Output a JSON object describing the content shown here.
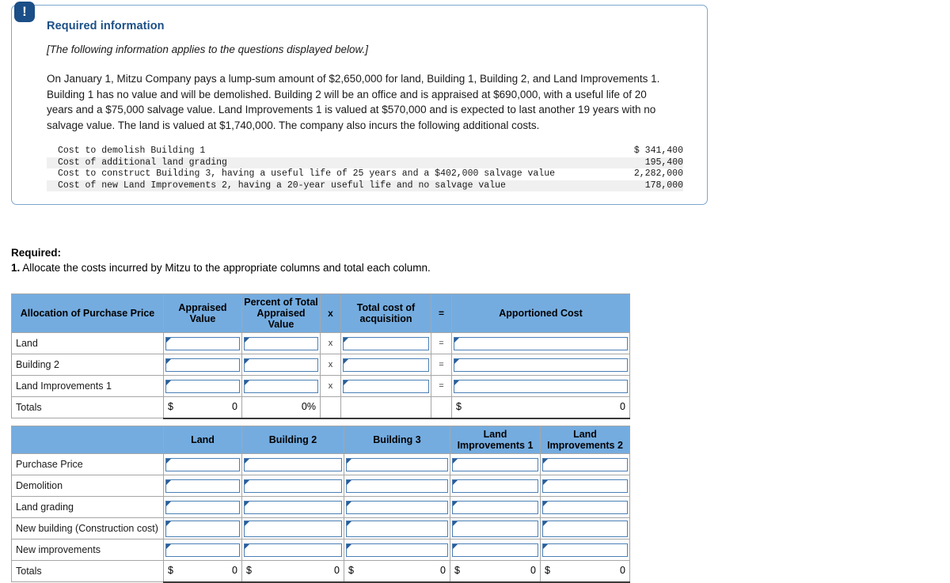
{
  "info_panel": {
    "badge_icon": "exclamation-icon",
    "badge_glyph": "!",
    "title": "Required information",
    "subtitle": "[The following information applies to the questions displayed below.]",
    "body": "On January 1, Mitzu Company pays a lump-sum amount of $2,650,000 for land, Building 1, Building 2, and Land Improvements 1. Building 1 has no value and will be demolished. Building 2 will be an office and is appraised at $690,000, with a useful life of 20 years and a $75,000 salvage value. Land Improvements 1 is valued at $570,000 and is expected to last another 19 years with no salvage value. The land is valued at $1,740,000. The company also incurs the following additional costs.",
    "cost_rows": [
      {
        "description": "Cost to demolish Building 1",
        "amount": "$ 341,400"
      },
      {
        "description": "Cost of additional land grading",
        "amount": "195,400"
      },
      {
        "description": "Cost to construct Building 3, having a useful life of 25 years and a $402,000 salvage value",
        "amount": "2,282,000"
      },
      {
        "description": "Cost of new Land Improvements 2, having a 20-year useful life and no salvage value",
        "amount": "178,000"
      }
    ]
  },
  "required": {
    "label": "Required:",
    "number": "1.",
    "text": "Allocate the costs incurred by Mitzu to the appropriate columns and total each column."
  },
  "table_allocation": {
    "headers": {
      "row_label": "Allocation of Purchase Price",
      "appraised_value": "Appraised Value",
      "percent_total": "Percent of Total Appraised Value",
      "op_times": "x",
      "total_cost": "Total cost of acquisition",
      "op_equals": "=",
      "apportioned_cost": "Apportioned Cost"
    },
    "rows": [
      {
        "label": "Land",
        "appraised_value": "",
        "percent_total": "",
        "op_times": "x",
        "total_cost": "",
        "op_equals": "=",
        "apportioned_cost": ""
      },
      {
        "label": "Building 2",
        "appraised_value": "",
        "percent_total": "",
        "op_times": "x",
        "total_cost": "",
        "op_equals": "=",
        "apportioned_cost": ""
      },
      {
        "label": "Land Improvements 1",
        "appraised_value": "",
        "percent_total": "",
        "op_times": "x",
        "total_cost": "",
        "op_equals": "=",
        "apportioned_cost": ""
      }
    ],
    "totals": {
      "label": "Totals",
      "appraised_currency": "$",
      "appraised_value": "0",
      "percent_total": "0%",
      "total_cost": "",
      "apportioned_currency": "$",
      "apportioned_cost": "0"
    }
  },
  "table_costs": {
    "headers": {
      "row_label": "",
      "land": "Land",
      "building_2": "Building 2",
      "building_3": "Building 3",
      "land_improvements_1": "Land Improvements 1",
      "land_improvements_2": "Land Improvements 2"
    },
    "rows": [
      {
        "label": "Purchase Price"
      },
      {
        "label": "Demolition"
      },
      {
        "label": "Land grading"
      },
      {
        "label": "New building (Construction cost)"
      },
      {
        "label": "New improvements"
      }
    ],
    "totals": {
      "label": "Totals",
      "currency": "$",
      "land": "0",
      "building_2": "0",
      "building_3": "0",
      "land_improvements_1": "0",
      "land_improvements_2": "0"
    }
  },
  "colors": {
    "header_blue": "#74ace0",
    "panel_border": "#7ba7ce",
    "badge_navy": "#1b4f87",
    "title_navy": "#1b4f87",
    "input_border": "#4a7fb5",
    "input_marker": "#2a5d96",
    "grid_border": "#a6a6a6",
    "zebra_gray": "#f0f0f0"
  }
}
